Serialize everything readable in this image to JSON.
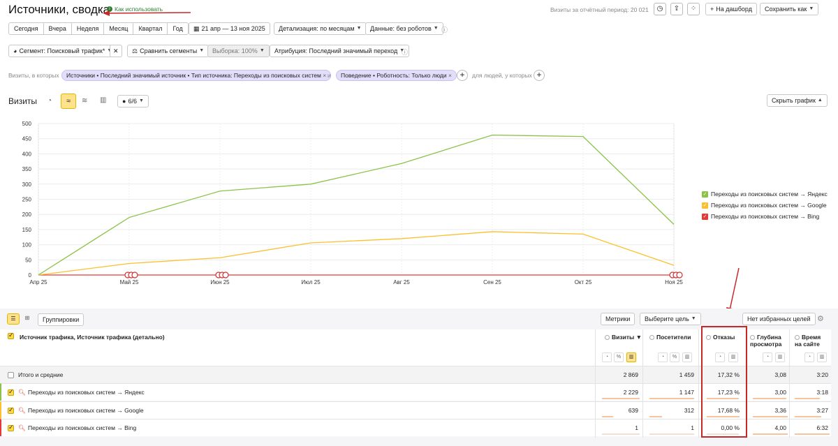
{
  "header": {
    "title": "Источники, сводка",
    "how_to_use": "Как использовать",
    "visits_period": "Визиты за отчётный период: 20 021",
    "to_dashboard": "На дашборд",
    "save_as": "Сохранить как"
  },
  "periods": [
    "Сегодня",
    "Вчера",
    "Неделя",
    "Месяц",
    "Квартал",
    "Год"
  ],
  "date_range": "21 апр — 13 ноя 2025",
  "detail": "Детализация: по месяцам",
  "data_filter": "Данные: без роботов",
  "segment": "Сегмент: Поисковый трафик*",
  "compare": "Сравнить сегменты",
  "sample": "Выборка: 100%",
  "attribution": "Атрибуция: Последний значимый переход",
  "filters": {
    "prefix": "Визиты, в которых",
    "tag1": "Источники • Последний значимый источник • Тип источника: Переходы из поисковых систем",
    "and": "и",
    "tag2": "Поведение • Роботность: Только люди",
    "people": "для людей, у которых"
  },
  "chart_header": {
    "title": "Визиты",
    "series_count": "6/6",
    "hide": "Скрыть график"
  },
  "chart_data": {
    "type": "line",
    "x": [
      "Апр 25",
      "Май 25",
      "Июн 25",
      "Июл 25",
      "Авг 25",
      "Сен 25",
      "Окт 25",
      "Ноя 25"
    ],
    "ylim": [
      0,
      500
    ],
    "yticks": [
      0,
      50,
      100,
      150,
      200,
      250,
      300,
      350,
      400,
      450,
      500
    ],
    "grid": true,
    "legend": "right",
    "series": [
      {
        "name": "Переходы из поисковых систем → Яндекс",
        "color": "#8bc34a",
        "values": [
          0,
          190,
          277,
          300,
          368,
          462,
          457,
          167
        ]
      },
      {
        "name": "Переходы из поисковых систем → Google",
        "color": "#fbc02d",
        "values": [
          0,
          38,
          57,
          106,
          120,
          143,
          135,
          32
        ]
      },
      {
        "name": "Переходы из поисковых систем → Bing",
        "color": "#e53935",
        "values": [
          0,
          0,
          0,
          0,
          0,
          0,
          0,
          0
        ]
      }
    ]
  },
  "table_toolbar": {
    "groupings": "Группировки",
    "metrics": "Метрики",
    "choose_goal": "Выберите цель",
    "no_favorites": "Нет избранных целей"
  },
  "table": {
    "dimension_header": "Источник трафика, Источник трафика (детально)",
    "col_visits": "Визиты",
    "col_visitors": "Посетители",
    "col_bounces": "Отказы",
    "col_depth_1": "Глубина",
    "col_depth_2": "просмотра",
    "col_time_1": "Время",
    "col_time_2": "на сайте",
    "rows": [
      {
        "label": "Итого и средние",
        "visits": "2 869",
        "visitors": "1 459",
        "bounces": "17,32 %",
        "depth": "3,08",
        "time": "3:20"
      },
      {
        "label": "Переходы из поисковых систем → Яндекс",
        "visits": "2 229",
        "visitors": "1 147",
        "bounces": "17,23 %",
        "depth": "3,00",
        "time": "3:18"
      },
      {
        "label": "Переходы из поисковых систем → Google",
        "visits": "639",
        "visitors": "312",
        "bounces": "17,68 %",
        "depth": "3,36",
        "time": "3:27"
      },
      {
        "label": "Переходы из поисковых систем → Bing",
        "visits": "1",
        "visitors": "1",
        "bounces": "0,00 %",
        "depth": "4,00",
        "time": "6:32"
      }
    ]
  }
}
